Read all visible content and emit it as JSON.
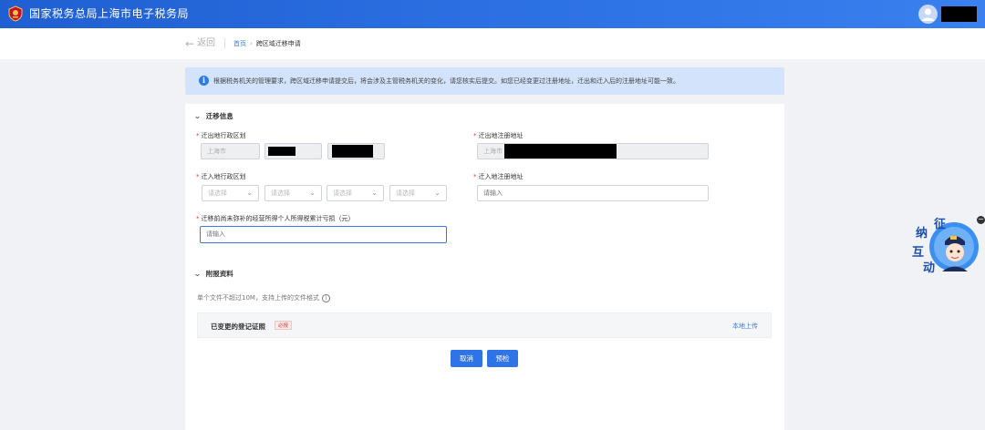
{
  "header": {
    "site_title": "国家税务总局上海市电子税务局"
  },
  "nav": {
    "back_label": "返回",
    "breadcrumb_home": "首页",
    "breadcrumb_sep": "›",
    "breadcrumb_current": "跨区域迁移申请"
  },
  "notice": {
    "icon_char": "i",
    "text": "根据税务机关的管理要求，跨区域迁移申请提交后，将会涉及主管税务机关的变化，请您核实后提交。如您已经变更过注册地址，迁出和迁入后的注册地址可能一致。"
  },
  "migration": {
    "section_title": "迁移信息",
    "out_region_label": "迁出地行政区划",
    "out_region_value": "上海市",
    "out_address_label": "迁出地注册地址",
    "out_address_value": "上海市",
    "in_region_label": "迁入地行政区划",
    "select_placeholder": "请选择",
    "in_address_label": "迁入地注册地址",
    "input_placeholder": "请输入",
    "loss_label": "迁移前尚未弥补的经营所得个人所得税累计亏损（元）",
    "required_mark": "*"
  },
  "attachments": {
    "section_title": "附报资料",
    "hint": "单个文件不超过10M，支持上传的文件格式",
    "hint_icon": "i",
    "item_name": "已变更的登记证照",
    "item_badge": "必报",
    "upload_label": "本地上传"
  },
  "actions": {
    "cancel": "取消",
    "precheck": "预检"
  },
  "float_widget": {
    "chars": [
      "征",
      "纳",
      "互",
      "动"
    ],
    "close": "−"
  },
  "colors": {
    "brand_blue": "#2e73e6",
    "required_red": "#e04040",
    "notice_bg": "#d2e3fb"
  }
}
